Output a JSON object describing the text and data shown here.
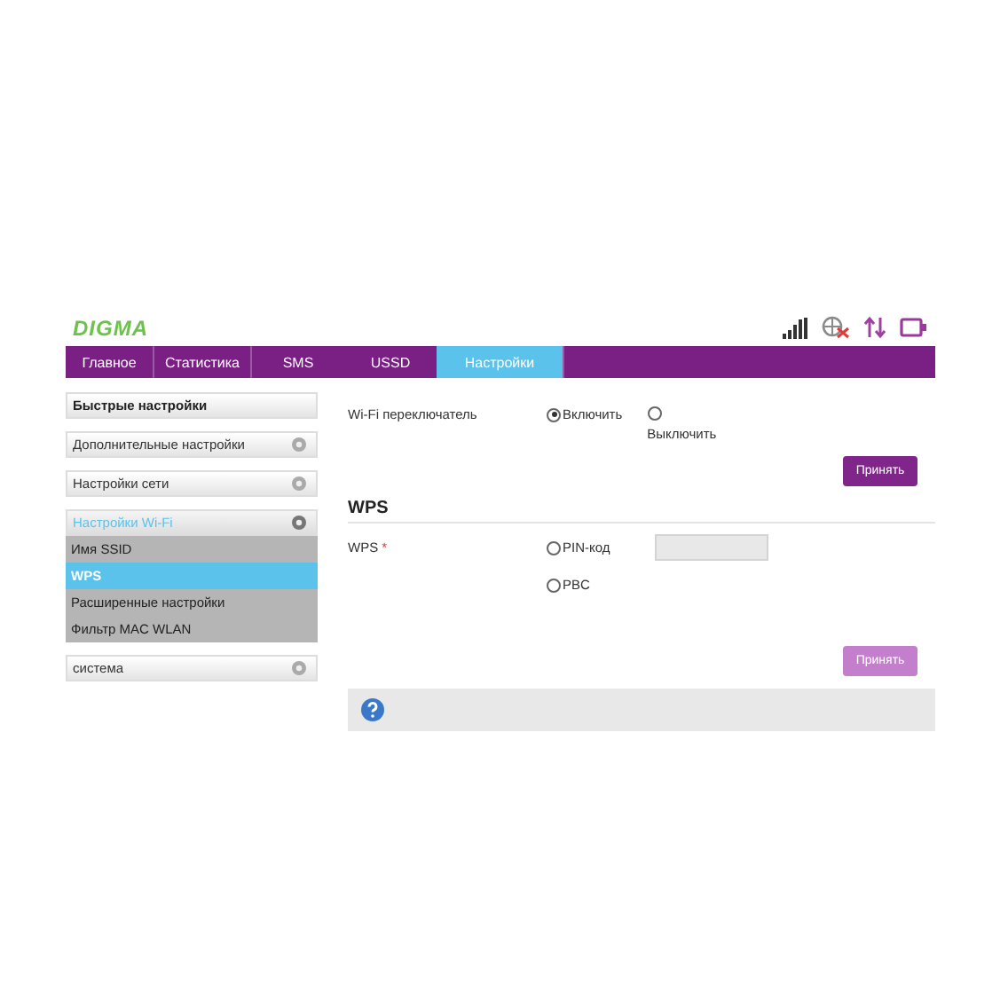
{
  "logo": "DIGMA",
  "tabs": [
    {
      "label": "Главное",
      "selected": false
    },
    {
      "label": "Статистика",
      "selected": false
    },
    {
      "label": "SMS",
      "selected": false
    },
    {
      "label": "USSD",
      "selected": false
    },
    {
      "label": "Настройки",
      "selected": true
    }
  ],
  "sidebar": {
    "groups": [
      {
        "label": "Быстрые настройки",
        "kind": "link"
      },
      {
        "label": "Дополнительные настройки",
        "kind": "group",
        "expanded": false
      },
      {
        "label": "Настройки сети",
        "kind": "group",
        "expanded": false
      },
      {
        "label": "Настройки Wi-Fi",
        "kind": "group",
        "expanded": true,
        "children": [
          {
            "label": "Имя SSID",
            "selected": false
          },
          {
            "label": "WPS",
            "selected": true
          },
          {
            "label": "Расширенные настройки",
            "selected": false
          },
          {
            "label": "Фильтр MAC WLAN",
            "selected": false
          }
        ]
      },
      {
        "label": "система",
        "kind": "group",
        "expanded": false
      }
    ]
  },
  "wifi_switch": {
    "label": "Wi-Fi переключатель",
    "options": [
      {
        "label": "Включить",
        "selected": true
      },
      {
        "label": "Выключить",
        "selected": false
      }
    ],
    "button": {
      "label": "Принять",
      "disabled": false
    }
  },
  "wps": {
    "title": "WPS",
    "label": "WPS",
    "required_mark": "*",
    "options": [
      {
        "label": "PIN-код",
        "selected": false,
        "kind": "pin"
      },
      {
        "label": "PBC",
        "selected": false,
        "kind": "plain"
      }
    ],
    "button": {
      "label": "Принять",
      "disabled": true
    }
  }
}
